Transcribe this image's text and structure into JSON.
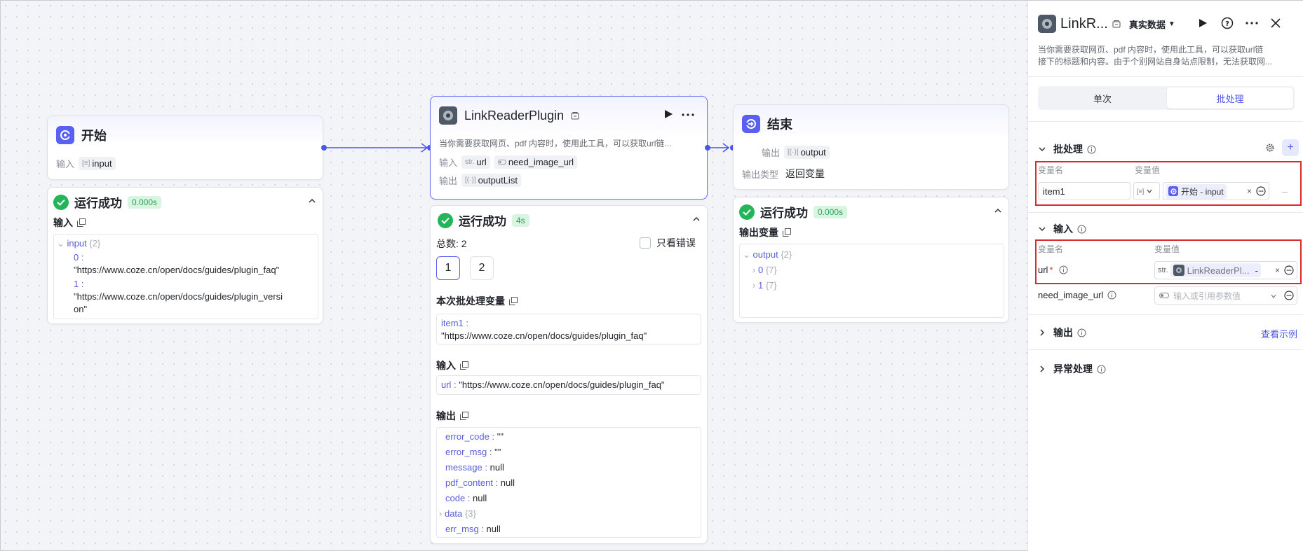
{
  "start_node": {
    "title": "开始",
    "input_label": "输入",
    "input_tag": "input",
    "run": {
      "status": "运行成功",
      "time": "0.000s"
    },
    "input_section": "输入",
    "tree": {
      "key": "input",
      "count": "{2}",
      "items": [
        {
          "index": "0 :",
          "value": "\"https://www.coze.cn/open/docs/guides/plugin_faq\""
        },
        {
          "index": "1 :",
          "value_line1": "\"https://www.coze.cn/open/docs/guides/plugin_versi",
          "value_line2": "on\""
        }
      ]
    }
  },
  "plugin_node": {
    "title": "LinkReaderPlugin",
    "description": "当你需要获取网页、pdf 内容时，使用此工具，可以获取url链...",
    "input_label": "输入",
    "output_label": "输出",
    "inputs": [
      {
        "type": "str.",
        "name": "url"
      },
      {
        "type": "toggle",
        "name": "need_image_url"
      }
    ],
    "output_tag": "outputList",
    "run": {
      "status": "运行成功",
      "time": "4s"
    },
    "total": "总数: 2",
    "only_errors": "只看错误",
    "pages": [
      "1",
      "2"
    ],
    "batch_var_title": "本次批处理变量",
    "batch_var": {
      "key": "item1 :",
      "value": "\"https://www.coze.cn/open/docs/guides/plugin_faq\""
    },
    "input_title": "输入",
    "input_kv": {
      "key": "url :",
      "value": "\"https://www.coze.cn/open/docs/guides/plugin_faq\""
    },
    "output_title": "输出",
    "outputs": [
      {
        "key": "error_code :",
        "value": "\"\""
      },
      {
        "key": "error_msg :",
        "value": "\"\""
      },
      {
        "key": "message :",
        "value": "null"
      },
      {
        "key": "pdf_content :",
        "value": "null"
      },
      {
        "key": "code :",
        "value": "null"
      },
      {
        "key": "data",
        "value": "{3}"
      },
      {
        "key": "err_msg :",
        "value": "null"
      }
    ]
  },
  "end_node": {
    "title": "结束",
    "output_label": "输出",
    "output_tag": "output",
    "output_type_label": "输出类型",
    "output_type_value": "返回变量",
    "run": {
      "status": "运行成功",
      "time": "0.000s"
    },
    "output_vars_title": "输出变量",
    "tree": {
      "key": "output",
      "count": "{2}",
      "items": [
        {
          "index": "0",
          "count": "{7}"
        },
        {
          "index": "1",
          "count": "{7}"
        }
      ]
    }
  },
  "panel": {
    "title": "LinkR...",
    "data_mode": "真实数据",
    "description_line1": "当你需要获取网页、pdf 内容时，使用此工具，可以获取url链",
    "description_line2": "接下的标题和内容。由于个别网站自身站点限制，无法获取网...",
    "tabs": [
      "单次",
      "批处理"
    ],
    "active_tab": "批处理",
    "batch_section": "批处理",
    "var_name_header": "变量名",
    "var_value_header": "变量值",
    "batch_item": {
      "name": "item1",
      "ref": "开始 - input"
    },
    "input_section": "输入",
    "inputs": [
      {
        "name": "url",
        "required": "*",
        "type": "str.",
        "ref": "LinkReaderPl...",
        "dash": "-"
      },
      {
        "name": "need_image_url",
        "placeholder": "输入或引用参数值"
      }
    ],
    "output_section": "输出",
    "view_example": "查看示例",
    "error_section": "异常处理"
  },
  "colors": {
    "accent": "#5a60f0",
    "success": "#24b45a",
    "highlight": "#d92a2a"
  }
}
